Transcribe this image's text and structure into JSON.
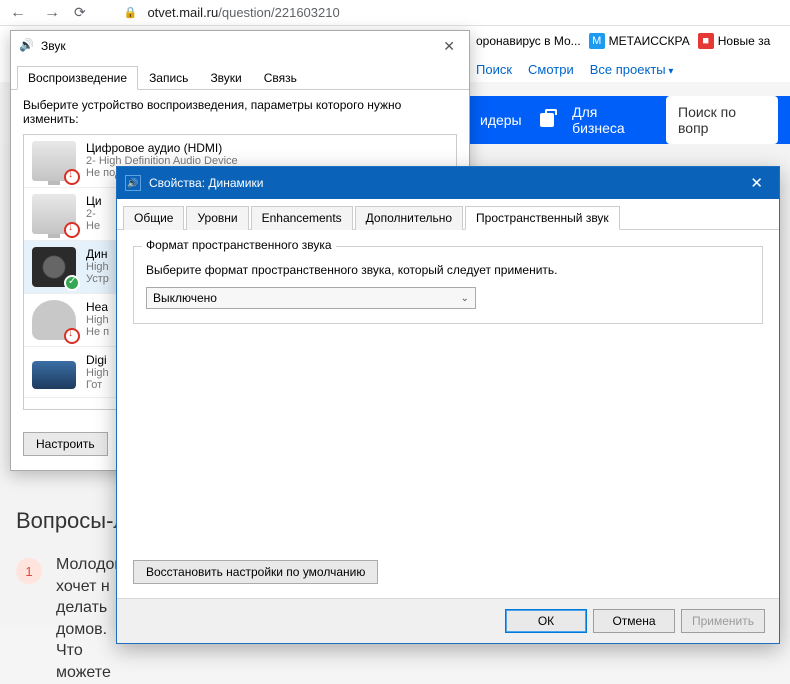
{
  "browser": {
    "url_host": "otvet.mail.ru",
    "url_path": "/question/221603210",
    "bookmarks": {
      "b1": "оронавирус в Мо...",
      "b2": "МЕТАИССКРА",
      "b3": "Новые за"
    },
    "mailnav": {
      "search": "Поиск",
      "watch": "Смотри",
      "projects": "Все проекты"
    },
    "bluebar": {
      "leaders": "идеры",
      "business": "Для бизнеса",
      "search_ph": "Поиск по вопр"
    }
  },
  "page": {
    "heading": "Вопросы-л",
    "qnum": "1",
    "qtext": "Молодой хочет н делать домов. Что можете"
  },
  "sound": {
    "title": "Звук",
    "tabs": {
      "t1": "Воспроизведение",
      "t2": "Запись",
      "t3": "Звуки",
      "t4": "Связь"
    },
    "instr": "Выберите устройство воспроизведения, параметры которого нужно изменить:",
    "devs": [
      {
        "name": "Цифровое аудио (HDMI)",
        "sub": "2- High Definition Audio Device",
        "status": "Не подключено"
      },
      {
        "name": "Ци",
        "sub": "2-",
        "status": "Не"
      },
      {
        "name": "Дин",
        "sub": "High",
        "status": "Устр"
      },
      {
        "name": "Hea",
        "sub": "High",
        "status": "Не п"
      },
      {
        "name": "Digi",
        "sub": "High",
        "status": "Гот"
      }
    ],
    "configure": "Настроить"
  },
  "props": {
    "title": "Свойства: Динамики",
    "tabs": {
      "t1": "Общие",
      "t2": "Уровни",
      "t3": "Enhancements",
      "t4": "Дополнительно",
      "t5": "Пространственный звук"
    },
    "legend": "Формат пространственного звука",
    "text": "Выберите формат пространственного звука, который следует применить.",
    "combo": "Выключено",
    "restore": "Восстановить настройки по умолчанию",
    "ok": "ОК",
    "cancel": "Отмена",
    "apply": "Применить"
  }
}
